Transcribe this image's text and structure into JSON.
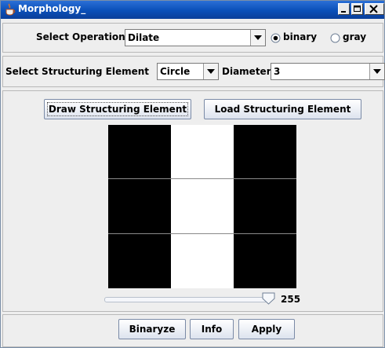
{
  "window": {
    "title": "Morphology_"
  },
  "operation": {
    "label": "Select Operation",
    "selected": "Dilate",
    "radios": [
      {
        "label": "binary",
        "checked": true
      },
      {
        "label": "gray",
        "checked": false
      }
    ]
  },
  "structuring": {
    "label": "Select Structuring Element",
    "shape": "Circle",
    "diameter_label": "Diameter",
    "diameter_value": "3"
  },
  "buttons": {
    "draw": "Draw Structuring Element",
    "load": "Load Structuring Element",
    "binaryze": "Binaryze",
    "info": "Info",
    "apply": "Apply"
  },
  "grid": {
    "rows": 3,
    "cols": 3,
    "cells": [
      [
        0,
        1,
        0
      ],
      [
        0,
        1,
        0
      ],
      [
        0,
        1,
        0
      ]
    ],
    "on_color": "#ffffff",
    "off_color": "#000000",
    "line_color": "#8a8a8a"
  },
  "slider": {
    "value": 255,
    "min": 0,
    "max": 255
  }
}
